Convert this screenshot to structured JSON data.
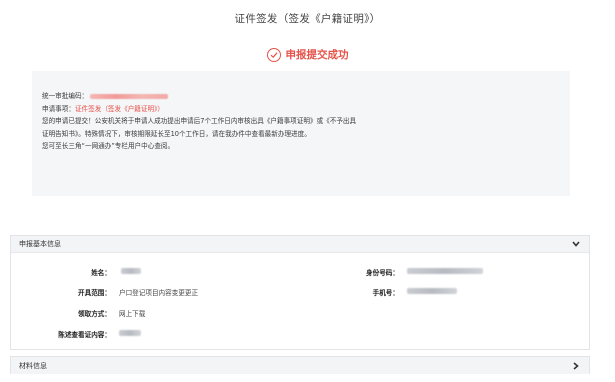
{
  "page": {
    "title": "证件签发（签发《户籍证明》）"
  },
  "status": {
    "text": "申报提交成功",
    "icon": "check-circle-icon",
    "color": "#e5534b"
  },
  "notice": {
    "approval_no_label": "统一审批编码：",
    "item_label": "申请事项：",
    "item_value": "证件签发（签发《户籍证明》）",
    "line3": "您的申请已提交！公安机关将于申请人成功提出申请后7个工作日内审核出具《户籍事项证明》或《不予出具",
    "line4": "证明告知书》。特殊情况下，审核期限延长至10个工作日，请在我办件中查看最新办理进度。",
    "line5": "您可至长三角“一网通办”专栏用户中心查阅。"
  },
  "basic_panel": {
    "title": "申报基本信息",
    "icon": "chevron-down-icon",
    "fields": {
      "name_label": "姓名：",
      "id_label": "身份号码：",
      "scope_label": "开具范围：",
      "scope_value": "户口登记项目内容变更更正",
      "phone_label": "手机号：",
      "method_label": "领取方式：",
      "method_value": "网上下载",
      "content_label": "陈述查看证内容："
    }
  },
  "material_panel": {
    "title": "材料信息",
    "icon": "chevron-right-icon"
  }
}
